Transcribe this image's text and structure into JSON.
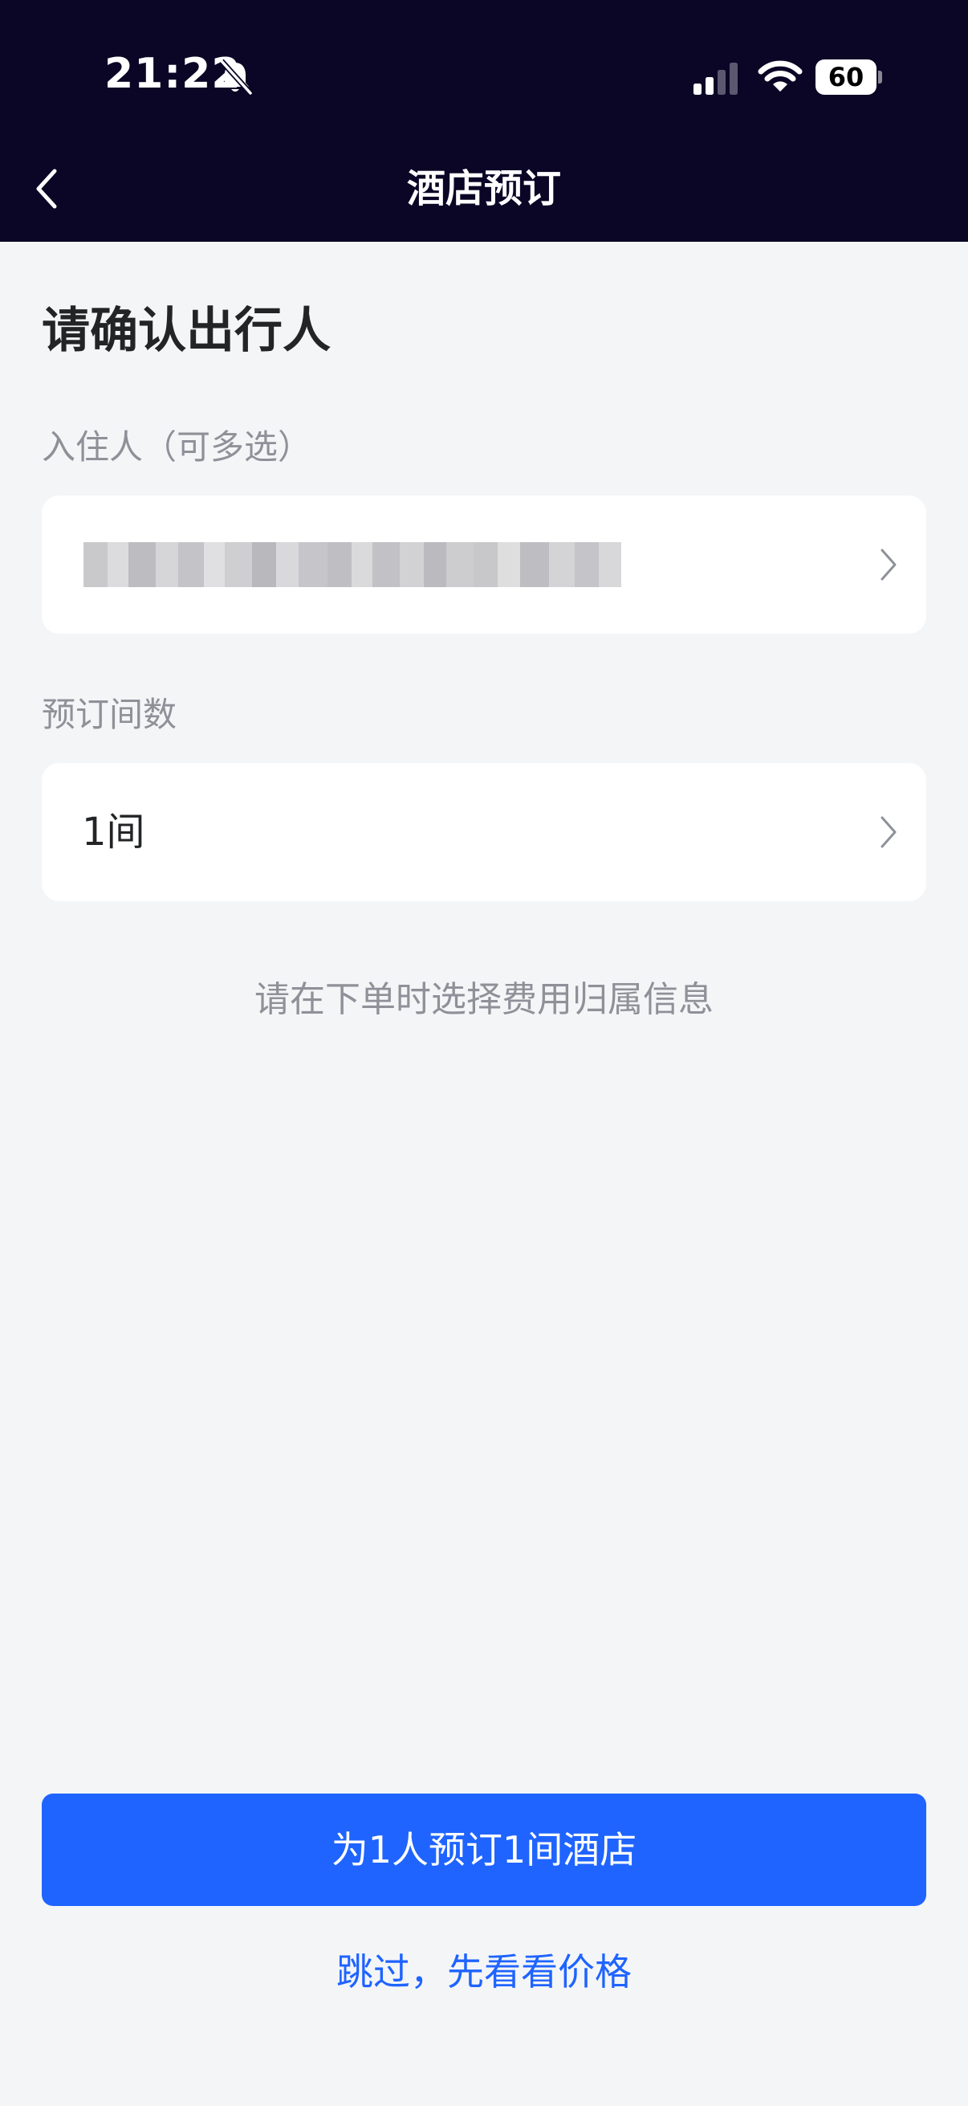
{
  "status_bar": {
    "time": "21:22",
    "battery": "60",
    "icons": [
      "bell-slash-icon",
      "signal-icon",
      "wifi-icon",
      "battery-icon"
    ]
  },
  "nav": {
    "title": "酒店预订",
    "back_icon": "chevron-left-icon"
  },
  "page": {
    "title": "请确认出行人"
  },
  "guests": {
    "label": "入住人（可多选）",
    "value_obscured": true
  },
  "rooms": {
    "label": "预订间数",
    "value": "1间"
  },
  "hint": "请在下单时选择费用归属信息",
  "actions": {
    "primary": "为1人预订1间酒店",
    "skip": "跳过，先看看价格"
  },
  "colors": {
    "header_bg": "#0b0626",
    "page_bg": "#f4f5f7",
    "accent": "#1f64ff",
    "muted_text": "#8e9198",
    "body_text": "#222426"
  }
}
